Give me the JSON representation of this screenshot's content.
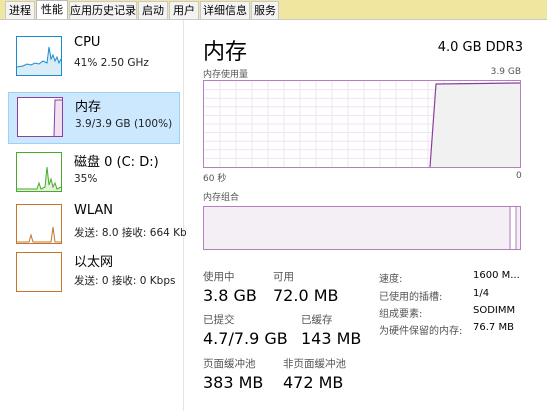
{
  "tabs": [
    {
      "label": "进程",
      "active": false
    },
    {
      "label": "性能",
      "active": true
    },
    {
      "label": "应用历史记录",
      "active": false
    },
    {
      "label": "启动",
      "active": false
    },
    {
      "label": "用户",
      "active": false
    },
    {
      "label": "详细信息",
      "active": false
    },
    {
      "label": "服务",
      "active": false
    }
  ],
  "sidebar": {
    "items": [
      {
        "name": "CPU",
        "sub": "41% 2.50 GHz",
        "color": "#1a8bd1",
        "selected": false
      },
      {
        "name": "内存",
        "sub": "3.9/3.9 GB (100%)",
        "color": "#8b3fa1",
        "selected": true
      },
      {
        "name": "磁盘 0 (C: D:)",
        "sub": "35%",
        "color": "#4aa82a",
        "selected": false
      },
      {
        "name": "WLAN",
        "sub": "发送: 8.0 接收: 664 Kb",
        "color": "#c5762a",
        "selected": false
      },
      {
        "name": "以太网",
        "sub": "发送: 0 接收: 0 Kbps",
        "color": "#c5762a",
        "selected": false
      }
    ]
  },
  "main": {
    "title": "内存",
    "spec": "4.0 GB DDR3",
    "usage_graph": {
      "label": "内存使用量",
      "max_label": "3.9 GB",
      "time_left": "60 秒",
      "time_right": "0"
    },
    "composition_label": "内存组合",
    "stats": {
      "in_use_label": "使用中",
      "in_use_value": "3.8 GB",
      "available_label": "可用",
      "available_value": "72.0 MB",
      "committed_label": "已提交",
      "committed_value": "4.7/7.9 GB",
      "cached_label": "已缓存",
      "cached_value": "143 MB",
      "paged_label": "页面缓冲池",
      "paged_value": "383 MB",
      "nonpaged_label": "非页面缓冲池",
      "nonpaged_value": "472 MB"
    },
    "info": [
      {
        "label": "速度:",
        "value": "1600 M..."
      },
      {
        "label": "已使用的插槽:",
        "value": "1/4"
      },
      {
        "label": "组成要素:",
        "value": "SODIMM"
      },
      {
        "label": "为硬件保留的内存:",
        "value": "76.7 MB"
      }
    ]
  },
  "colors": {
    "memory_accent": "#8b3fa1",
    "selected_bg": "#cce8ff"
  }
}
